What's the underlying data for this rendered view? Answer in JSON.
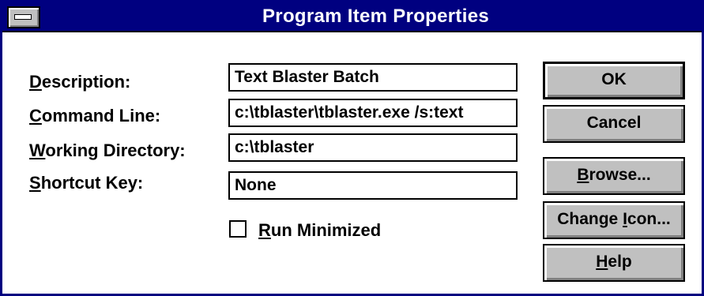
{
  "window": {
    "title": "Program Item Properties",
    "title_bar_color": "#000080",
    "face_color": "#c0c0c0"
  },
  "fields": [
    {
      "label_access": "D",
      "label_rest": "escription:",
      "value": "Text Blaster Batch"
    },
    {
      "label_access": "C",
      "label_rest": "ommand Line:",
      "value": "c:\\tblaster\\tblaster.exe /s:text"
    },
    {
      "label_access": "W",
      "label_rest": "orking Directory:",
      "value": "c:\\tblaster"
    },
    {
      "label_access": "S",
      "label_rest": "hortcut Key:",
      "value": "None"
    }
  ],
  "run_minimized": {
    "checked": false,
    "label_access": "R",
    "label_rest": "un Minimized"
  },
  "buttons": {
    "ok": {
      "label": "OK"
    },
    "cancel": {
      "label": "Cancel"
    },
    "browse": {
      "label_access": "B",
      "label_rest": "rowse..."
    },
    "change_icon": {
      "label_pre": "Change ",
      "label_access": "I",
      "label_rest": "con..."
    },
    "help": {
      "label_access": "H",
      "label_rest": "elp"
    }
  }
}
